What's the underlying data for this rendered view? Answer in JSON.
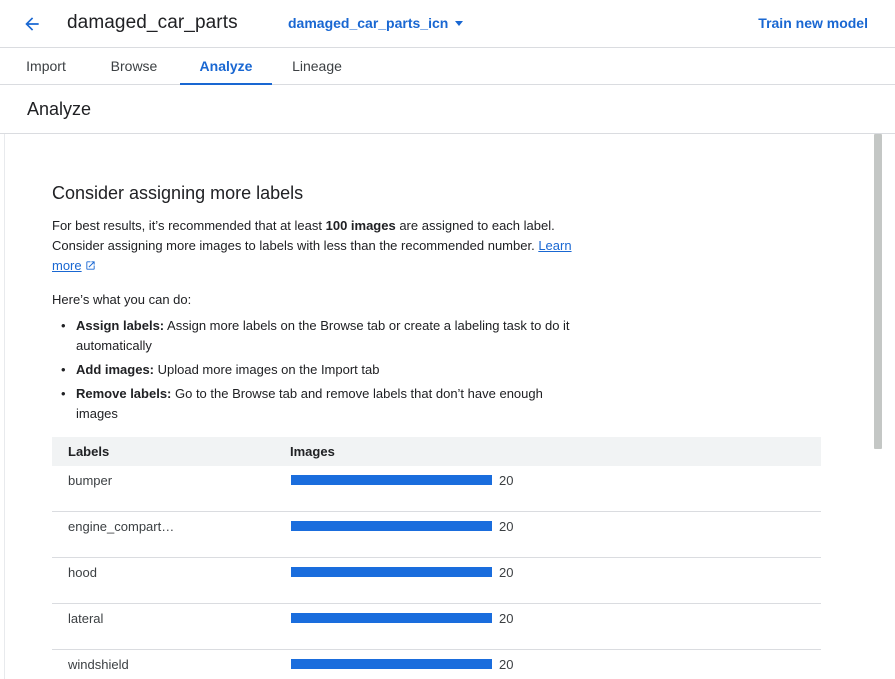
{
  "header": {
    "title": "damaged_car_parts",
    "dataset": "damaged_car_parts_icn",
    "train_button": "Train new model"
  },
  "tabs": [
    {
      "label": "Import",
      "active": false
    },
    {
      "label": "Browse",
      "active": false
    },
    {
      "label": "Analyze",
      "active": true
    },
    {
      "label": "Lineage",
      "active": false
    }
  ],
  "section": {
    "title": "Analyze"
  },
  "card": {
    "heading": "Consider assigning more labels",
    "para_pre": "For best results, it’s recommended that at least ",
    "para_bold": "100 images",
    "para_post": " are assigned to each label. Consider assigning more images to labels with less than the recommended number. ",
    "learn_more": "Learn more",
    "todo_intro": "Here’s what you can do:",
    "tips": [
      {
        "title": "Assign labels:",
        "text": " Assign more labels on the Browse tab or create a labeling task to do it automatically"
      },
      {
        "title": "Add images:",
        "text": " Upload more images on the Import tab"
      },
      {
        "title": "Remove labels:",
        "text": " Go to the Browse tab and remove labels that don’t have enough images"
      }
    ]
  },
  "table": {
    "col_labels": "Labels",
    "col_images": "Images",
    "bar_max": 20,
    "rows": [
      {
        "label": "bumper",
        "count": 20
      },
      {
        "label": "engine_compart…",
        "count": 20
      },
      {
        "label": "hood",
        "count": 20
      },
      {
        "label": "lateral",
        "count": 20
      },
      {
        "label": "windshield",
        "count": 20
      }
    ]
  },
  "colors": {
    "accent": "#1967d2",
    "bar": "#1a6ddd"
  },
  "icons": {
    "back": "arrow-back-icon",
    "dropdown": "caret-down-icon",
    "external": "open-in-new-icon"
  }
}
